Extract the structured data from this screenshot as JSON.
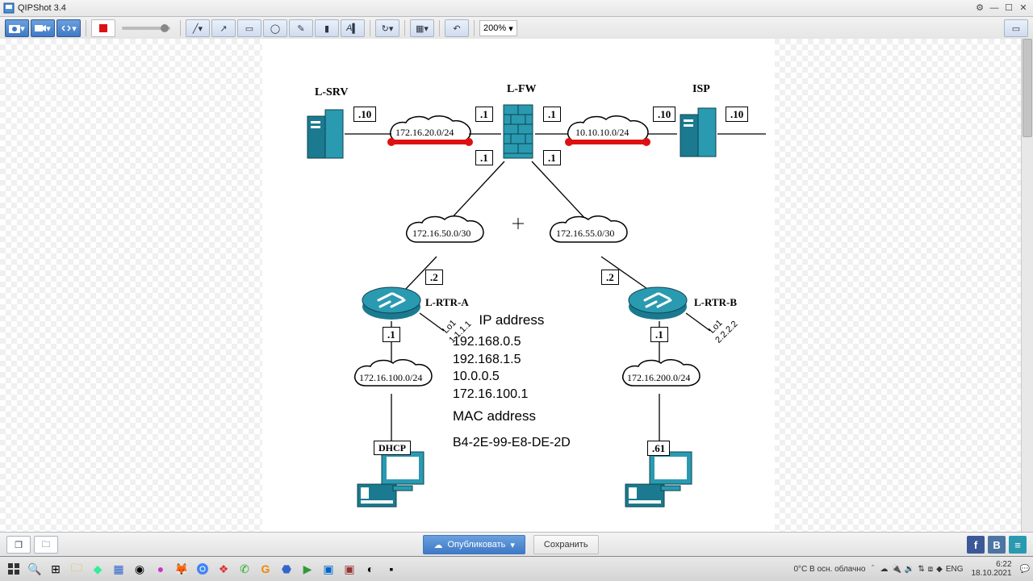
{
  "app": {
    "title": "QIPShot 3.4",
    "zoom": "200%"
  },
  "toolbar": {
    "publish": "Опубликовать",
    "save": "Сохранить"
  },
  "tray": {
    "weather": "0°C  В осн. облачно",
    "lang": "ENG",
    "time": "6:22",
    "date": "18.10.2021"
  },
  "diagram": {
    "nodes": {
      "lsrv": "L-SRV",
      "lfw": "L-FW",
      "isp": "ISP",
      "lrtra": "L-RTR-A",
      "lrtrb": "L-RTR-B",
      "dhcp": "DHCP"
    },
    "nets": {
      "n1": "172.16.20.0/24",
      "n2": "10.10.10.0/24",
      "n3": "172.16.50.0/30",
      "n4": "172.16.55.0/30",
      "n5": "172.16.100.0/24",
      "n6": "172.16.200.0/24"
    },
    "ips": {
      "lsrv": ".10",
      "fw_l_t": ".1",
      "fw_r_t": ".1",
      "fw_l_b": ".1",
      "fw_r_b": ".1",
      "isp_l": ".10",
      "isp_r": ".10",
      "rtra_t": ".2",
      "rtra_b": ".1",
      "rtrb_t": ".2",
      "rtrb_b": ".1",
      "pc_b": ".61"
    },
    "lo": {
      "a1": "Lo1",
      "a2": "1.1.1.1",
      "b1": "Lo1",
      "b2": "2.2.2.2"
    },
    "info": {
      "h1": "IP address",
      "l1": "192.168.0.5",
      "l2": "192.168.1.5",
      "l3": "10.0.0.5",
      "l4": "172.16.100.1",
      "h2": "MAC address",
      "l5": "B4-2E-99-E8-DE-2D"
    }
  }
}
